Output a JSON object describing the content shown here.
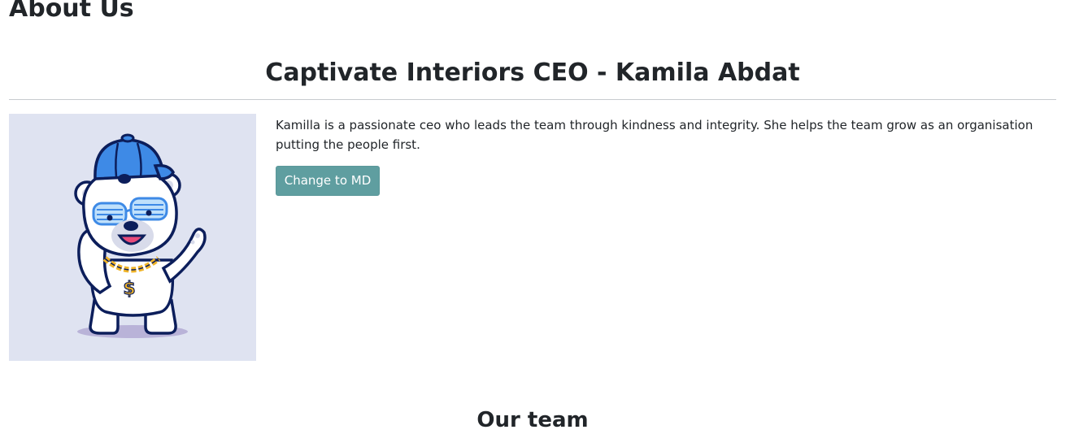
{
  "page": {
    "heading": "About Us"
  },
  "profile": {
    "title": "Captivate Interiors CEO - Kamila Abdat",
    "bio": "Kamilla is a passionate ceo who leads the team through kindness and integrity. She helps the team grow as an organisation putting the people first.",
    "button_label": "Change to MD",
    "image_icon": "polar-bear-cap-sunglasses-gold-chain-illustration"
  },
  "team": {
    "heading": "Our team"
  },
  "colors": {
    "button": "#5f9ea0",
    "image_background": "#dfe3f1",
    "text": "#212529",
    "divider": "#c8cbcf"
  }
}
